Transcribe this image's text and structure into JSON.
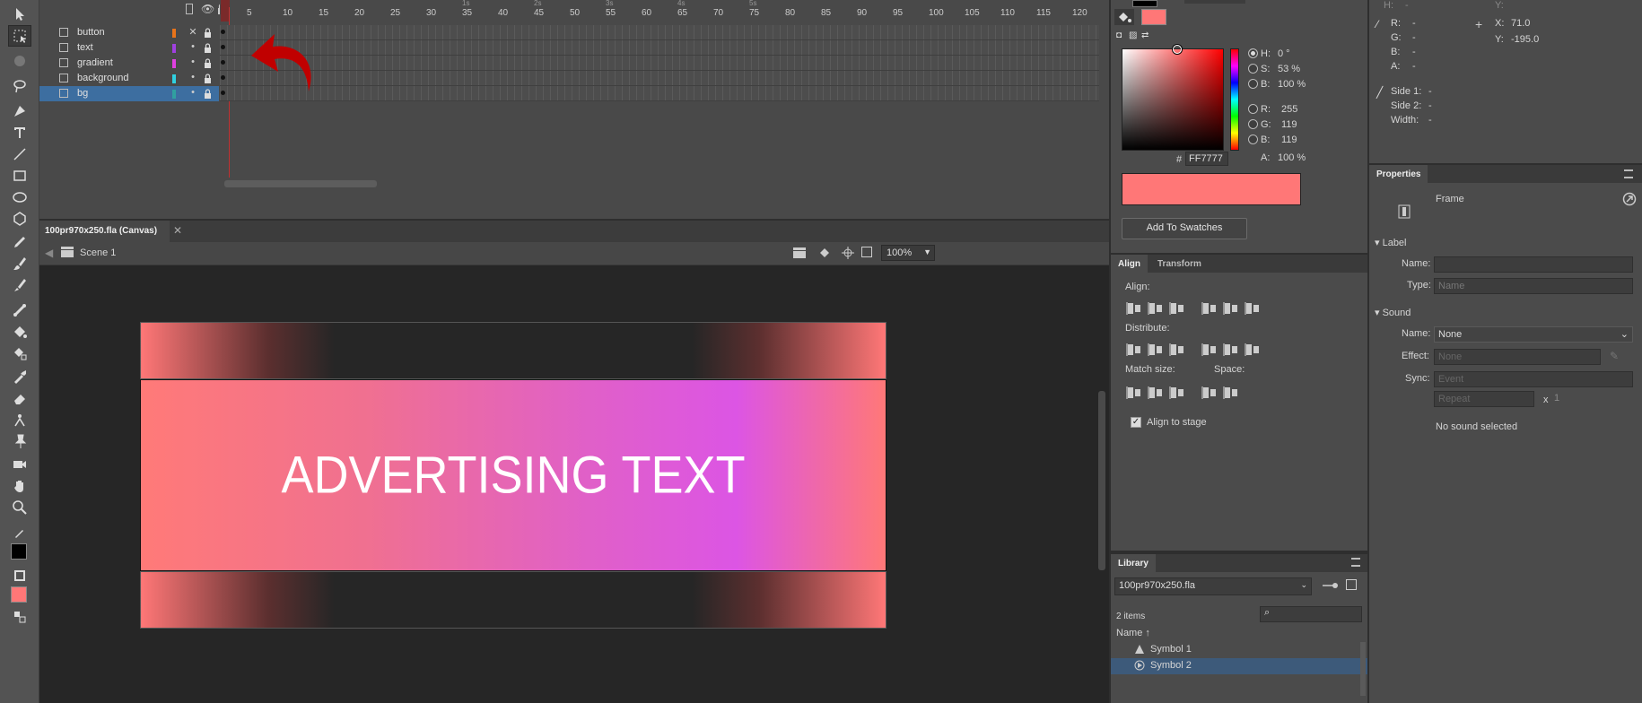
{
  "timeline": {
    "frame_numbers": [
      "1",
      "5",
      "10",
      "15",
      "20",
      "25",
      "30",
      "35",
      "40",
      "45",
      "50",
      "55",
      "60",
      "65",
      "70",
      "75",
      "80",
      "85",
      "90",
      "95",
      "100",
      "105",
      "110",
      "115",
      "120"
    ],
    "fps_marks": [
      "1s",
      "2s",
      "3s",
      "4s",
      "5s"
    ],
    "layers": [
      {
        "name": "button",
        "color": "#e8741a"
      },
      {
        "name": "text",
        "color": "#a040e0"
      },
      {
        "name": "gradient",
        "color": "#e040e0"
      },
      {
        "name": "background",
        "color": "#30d0e0"
      },
      {
        "name": "bg",
        "color": "#30a0a0"
      }
    ]
  },
  "document": {
    "tab_label": "100pr970x250.fla (Canvas)",
    "scene_label": "Scene 1",
    "zoom": "100%"
  },
  "stage": {
    "banner_text": "ADVERTISING TEXT"
  },
  "color": {
    "h_label": "H:",
    "h_value": "0 °",
    "s_label": "S:",
    "s_value": "53 %",
    "b_label": "B:",
    "b_value": "100 %",
    "r_label": "R:",
    "r_value": "255",
    "g_label": "G:",
    "g_value": "119",
    "b2_label": "B:",
    "b2_value": "119",
    "a_label": "A:",
    "a_value": "100 %",
    "hex_prefix": "#",
    "hex_value": "FF7777",
    "add_swatch_label": "Add To Swatches",
    "fill_color": "#ff7777"
  },
  "align": {
    "tab_align": "Align",
    "tab_transform": "Transform",
    "align_label": "Align:",
    "distribute_label": "Distribute:",
    "match_size_label": "Match size:",
    "space_label": "Space:",
    "align_to_stage_label": "Align to stage"
  },
  "library": {
    "tab_label": "Library",
    "file": "100pr970x250.fla",
    "count": "2 items",
    "name_header": "Name",
    "items": [
      "Symbol 1",
      "Symbol 2"
    ]
  },
  "info": {
    "h_label": "H:",
    "h_value": "-",
    "y_top_label": "Y:",
    "r_label": "R:",
    "r_value": "-",
    "g_label": "G:",
    "g_value": "-",
    "b_label": "B:",
    "b_value": "-",
    "a_label": "A:",
    "a_value": "-",
    "x_label": "X:",
    "x_value": "71.0",
    "y_label": "Y:",
    "y_value": "-195.0",
    "side1_label": "Side 1:",
    "side1_value": "-",
    "side2_label": "Side 2:",
    "side2_value": "-",
    "width_label": "Width:",
    "width_value": "-"
  },
  "properties": {
    "tab_label": "Properties",
    "type_label": "Frame",
    "label_section": "Label",
    "name_label": "Name:",
    "type_field_label": "Type:",
    "type_value": "Name",
    "sound_section": "Sound",
    "sound_name_label": "Name:",
    "sound_name_value": "None",
    "effect_label": "Effect:",
    "effect_value": "None",
    "sync_label": "Sync:",
    "sync_value": "Event",
    "repeat_value": "Repeat",
    "repeat_x": "x",
    "repeat_count": "1",
    "no_sound": "No sound selected"
  }
}
